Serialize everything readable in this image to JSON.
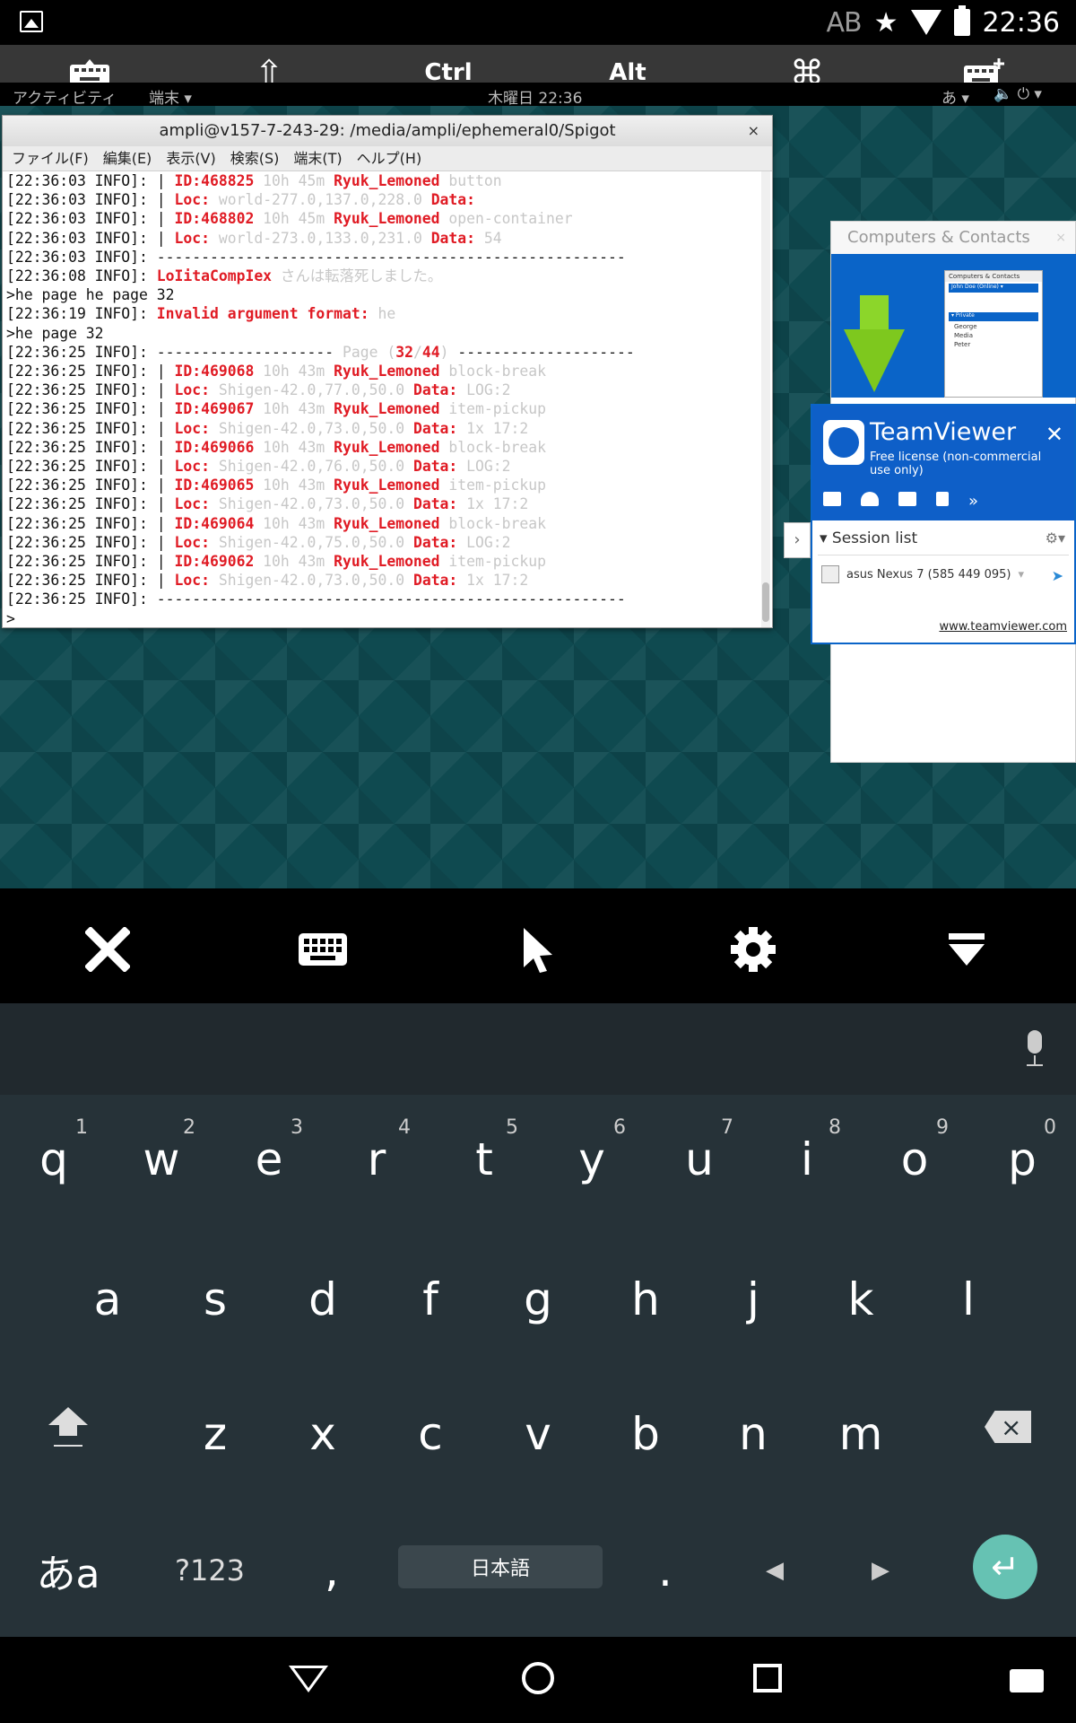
{
  "status_bar": {
    "ab": "AB",
    "time": "22:36",
    "icons": [
      "picture-icon",
      "star-icon",
      "wifi-icon",
      "battery-icon"
    ]
  },
  "remote_toolbar": {
    "keyboard_toggle": "keyboard-icon",
    "shift": "⇧",
    "ctrl": "Ctrl",
    "alt": "Alt",
    "cmd": "⌘",
    "add_keyboard": "keyboard-plus-icon"
  },
  "gnome_bar": {
    "activities": "アクティビティ",
    "app": "端末 ▾",
    "clock": "木曜日 22:36",
    "ime": "あ ▾",
    "right": "🔈 ⏻ ▾"
  },
  "terminal": {
    "title": "ampli@v157-7-243-29: /media/ampli/ephemeral0/Spigot",
    "close": "×",
    "menu": [
      "ファイル(F)",
      "編集(E)",
      "表示(V)",
      "検索(S)",
      "端末(T)",
      "ヘルプ(H)"
    ],
    "lines": [
      [
        [
          "",
          "[22:36:03 INFO]: | "
        ],
        [
          "r",
          "ID:468825"
        ],
        [
          "g",
          " 10h 45m "
        ],
        [
          "r",
          "Ryuk_Lemoned"
        ],
        [
          "g",
          " button"
        ]
      ],
      [
        [
          "",
          "[22:36:03 INFO]: | "
        ],
        [
          "r",
          "Loc:"
        ],
        [
          "g",
          " world-277.0,137.0,228.0 "
        ],
        [
          "r",
          "Data:"
        ]
      ],
      [
        [
          "",
          "[22:36:03 INFO]: | "
        ],
        [
          "r",
          "ID:468802"
        ],
        [
          "g",
          " 10h 45m "
        ],
        [
          "r",
          "Ryuk_Lemoned"
        ],
        [
          "g",
          " open-container"
        ]
      ],
      [
        [
          "",
          "[22:36:03 INFO]: | "
        ],
        [
          "r",
          "Loc:"
        ],
        [
          "g",
          " world-273.0,133.0,231.0 "
        ],
        [
          "r",
          "Data:"
        ],
        [
          "g",
          " 54"
        ]
      ],
      [
        [
          "",
          "[22:36:03 INFO]: -----------------------------------------------------"
        ]
      ],
      [
        [
          "",
          "[22:36:08 INFO]: "
        ],
        [
          "r",
          "LoIitaCompIex"
        ],
        [
          "g",
          " さんは転落死しました。"
        ]
      ],
      [
        [
          "",
          ">he page he page 32"
        ]
      ],
      [
        [
          "",
          "[22:36:19 INFO]: "
        ],
        [
          "r",
          "Invalid argument format:"
        ],
        [
          "g",
          " he"
        ]
      ],
      [
        [
          "",
          ">he page 32"
        ]
      ],
      [
        [
          "",
          "[22:36:25 INFO]: -------------------- "
        ],
        [
          "g",
          "Page ("
        ],
        [
          "r",
          "32"
        ],
        [
          "g",
          "/"
        ],
        [
          "r",
          "44"
        ],
        [
          "g",
          ")"
        ],
        [
          "",
          " --------------------"
        ]
      ],
      [
        [
          "",
          "[22:36:25 INFO]: | "
        ],
        [
          "r",
          "ID:469068"
        ],
        [
          "g",
          " 10h 43m "
        ],
        [
          "r",
          "Ryuk_Lemoned"
        ],
        [
          "g",
          " block-break"
        ]
      ],
      [
        [
          "",
          "[22:36:25 INFO]: | "
        ],
        [
          "r",
          "Loc:"
        ],
        [
          "g",
          " Shigen-42.0,77.0,50.0 "
        ],
        [
          "r",
          "Data:"
        ],
        [
          "g",
          " LOG:2"
        ]
      ],
      [
        [
          "",
          "[22:36:25 INFO]: | "
        ],
        [
          "r",
          "ID:469067"
        ],
        [
          "g",
          " 10h 43m "
        ],
        [
          "r",
          "Ryuk_Lemoned"
        ],
        [
          "g",
          " item-pickup"
        ]
      ],
      [
        [
          "",
          "[22:36:25 INFO]: | "
        ],
        [
          "r",
          "Loc:"
        ],
        [
          "g",
          " Shigen-42.0,73.0,50.0 "
        ],
        [
          "r",
          "Data:"
        ],
        [
          "g",
          " 1x 17:2"
        ]
      ],
      [
        [
          "",
          "[22:36:25 INFO]: | "
        ],
        [
          "r",
          "ID:469066"
        ],
        [
          "g",
          " 10h 43m "
        ],
        [
          "r",
          "Ryuk_Lemoned"
        ],
        [
          "g",
          " block-break"
        ]
      ],
      [
        [
          "",
          "[22:36:25 INFO]: | "
        ],
        [
          "r",
          "Loc:"
        ],
        [
          "g",
          " Shigen-42.0,76.0,50.0 "
        ],
        [
          "r",
          "Data:"
        ],
        [
          "g",
          " LOG:2"
        ]
      ],
      [
        [
          "",
          "[22:36:25 INFO]: | "
        ],
        [
          "r",
          "ID:469065"
        ],
        [
          "g",
          " 10h 43m "
        ],
        [
          "r",
          "Ryuk_Lemoned"
        ],
        [
          "g",
          " item-pickup"
        ]
      ],
      [
        [
          "",
          "[22:36:25 INFO]: | "
        ],
        [
          "r",
          "Loc:"
        ],
        [
          "g",
          " Shigen-42.0,73.0,50.0 "
        ],
        [
          "r",
          "Data:"
        ],
        [
          "g",
          " 1x 17:2"
        ]
      ],
      [
        [
          "",
          "[22:36:25 INFO]: | "
        ],
        [
          "r",
          "ID:469064"
        ],
        [
          "g",
          " 10h 43m "
        ],
        [
          "r",
          "Ryuk_Lemoned"
        ],
        [
          "g",
          " block-break"
        ]
      ],
      [
        [
          "",
          "[22:36:25 INFO]: | "
        ],
        [
          "r",
          "Loc:"
        ],
        [
          "g",
          " Shigen-42.0,75.0,50.0 "
        ],
        [
          "r",
          "Data:"
        ],
        [
          "g",
          " LOG:2"
        ]
      ],
      [
        [
          "",
          "[22:36:25 INFO]: | "
        ],
        [
          "r",
          "ID:469062"
        ],
        [
          "g",
          " 10h 43m "
        ],
        [
          "r",
          "Ryuk_Lemoned"
        ],
        [
          "g",
          " item-pickup"
        ]
      ],
      [
        [
          "",
          "[22:36:25 INFO]: | "
        ],
        [
          "r",
          "Loc:"
        ],
        [
          "g",
          " Shigen-42.0,73.0,50.0 "
        ],
        [
          "r",
          "Data:"
        ],
        [
          "g",
          " 1x 17:2"
        ]
      ],
      [
        [
          "",
          "[22:36:25 INFO]: -----------------------------------------------------"
        ]
      ],
      [
        [
          "",
          ">"
        ]
      ]
    ]
  },
  "contacts_window": {
    "title": "Computers & Contacts",
    "close": "×",
    "mini": {
      "title": "Computers & Contacts",
      "user": "John Doe (Online) ▾",
      "group": "▾ Private",
      "items": [
        "George",
        "Media",
        "Peter"
      ]
    }
  },
  "teamviewer": {
    "name": "TeamViewer",
    "subtitle": "Free license (non-commercial use only)",
    "close": "✕",
    "icons": [
      "video-icon",
      "headset-icon",
      "chat-icon",
      "file-icon",
      "more-icon"
    ],
    "more": "»",
    "tab_arrow": "›",
    "session_list": "▾ Session list",
    "gear": "⚙▾",
    "device": "asus Nexus 7 (585 449 095)",
    "device_arrow": "▾",
    "pointer": "➤",
    "link": "www.teamviewer.com"
  },
  "control_bar": {
    "close": "✕",
    "keyboard": "⌨",
    "pointer": "➤",
    "settings": "⚙",
    "collapse": "⏷"
  },
  "keyboard": {
    "row1": [
      {
        "k": "q",
        "n": "1"
      },
      {
        "k": "w",
        "n": "2"
      },
      {
        "k": "e",
        "n": "3"
      },
      {
        "k": "r",
        "n": "4"
      },
      {
        "k": "t",
        "n": "5"
      },
      {
        "k": "y",
        "n": "6"
      },
      {
        "k": "u",
        "n": "7"
      },
      {
        "k": "i",
        "n": "8"
      },
      {
        "k": "o",
        "n": "9"
      },
      {
        "k": "p",
        "n": "0"
      }
    ],
    "row2": [
      "a",
      "s",
      "d",
      "f",
      "g",
      "h",
      "j",
      "k",
      "l"
    ],
    "row3": [
      "z",
      "x",
      "c",
      "v",
      "b",
      "n",
      "m"
    ],
    "lang_switch": "あa",
    "symbols": "?123",
    "comma": ",",
    "space": "日本語",
    "period": ".",
    "left": "◀",
    "right": "▶",
    "enter": "↵"
  },
  "nav_bar": {
    "icons": [
      "back-icon",
      "home-icon",
      "recent-apps-icon",
      "keyboard-icon"
    ]
  }
}
